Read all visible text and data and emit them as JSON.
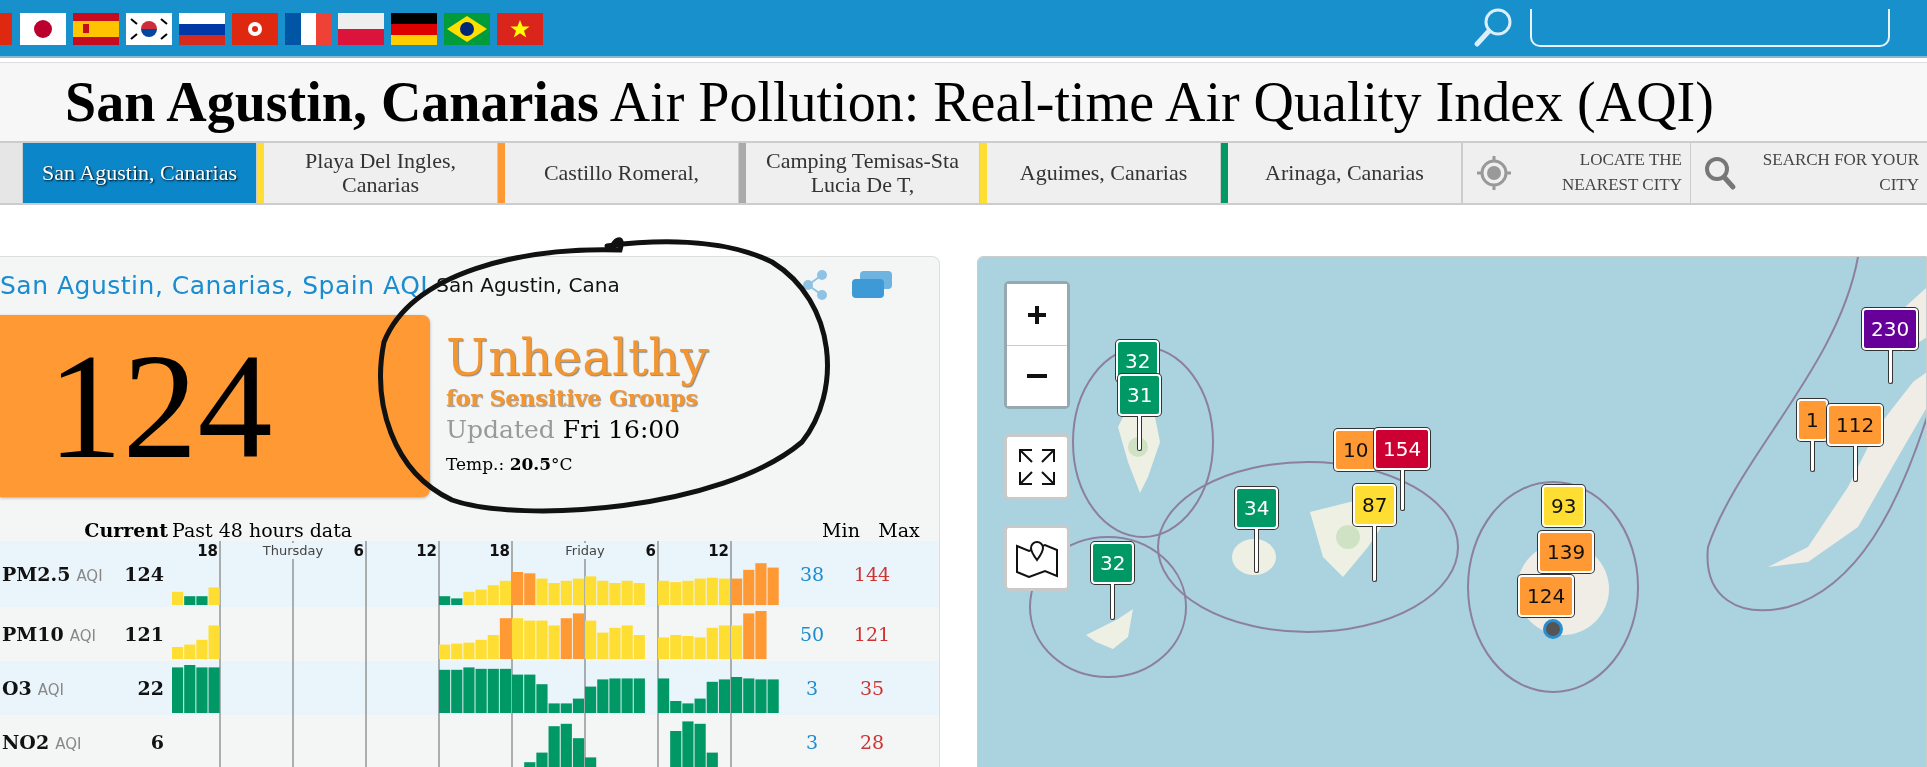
{
  "title": "**San Agustin, Canarias** Air Pollution: Real-time Air Quality Index (AQI)",
  "nav_tabs": [
    {
      "label": "San Agustin, Canarias",
      "selected": true
    },
    {
      "label": "Playa Del Ingles, Canarias",
      "selected": false,
      "color": "#ffde33"
    },
    {
      "label": "Castillo Romeral,",
      "selected": false,
      "color": "#ff9933"
    },
    {
      "label": "Camping Temisas-Sta Lucia De T,",
      "selected": false,
      "color": "#aaaaaa"
    },
    {
      "label": "Aguimes, Canarias",
      "selected": false,
      "color": "#ffde33"
    },
    {
      "label": "Arinaga, Canarias",
      "selected": false,
      "color": "#009966"
    }
  ],
  "nav_actions": [
    {
      "kind": "locate",
      "label": "LOCATE THE NEAREST CITY"
    },
    {
      "kind": "search",
      "label": "SEARCH FOR YOUR CITY"
    }
  ],
  "station": {
    "heading": "San Agustin, Canarias, Spain AQI",
    "name": "San Agustin, Cana",
    "aqi": "124",
    "status": "Unhealthy",
    "status_detail": "for Sensitive Groups",
    "updated_label": "Updated",
    "updated": "Fri 16:00",
    "temperature": "Temp.: **20.5**°C"
  },
  "table": {
    "current_header": "Current",
    "history_header": "Past 48 hours data",
    "min_header": "Min",
    "max_header": "Max",
    "ticks": [
      {
        "label": "18",
        "kind": "hour"
      },
      {
        "label": "Thursday",
        "kind": "day"
      },
      {
        "label": "6",
        "kind": "hour"
      },
      {
        "label": "12",
        "kind": "hour"
      },
      {
        "label": "18",
        "kind": "hour"
      },
      {
        "label": "Friday",
        "kind": "day"
      },
      {
        "label": "6",
        "kind": "hour"
      },
      {
        "label": "12",
        "kind": "hour"
      }
    ],
    "rows": [
      {
        "name": "PM2.5",
        "unit": "AQI",
        "current": "124",
        "min": "38",
        "max": "144"
      },
      {
        "name": "PM10",
        "unit": "AQI",
        "current": "121",
        "min": "50",
        "max": "121"
      },
      {
        "name": "O3",
        "unit": "AQI",
        "current": "22",
        "min": "3",
        "max": "35"
      },
      {
        "name": "NO2",
        "unit": "AQI",
        "current": "6",
        "min": "3",
        "max": "28"
      }
    ]
  },
  "map": {
    "markers": [
      {
        "value": "32",
        "color": "#009966"
      },
      {
        "value": "31",
        "color": "#009966"
      },
      {
        "value": "34",
        "color": "#009966"
      },
      {
        "value": "32",
        "color": "#009966"
      },
      {
        "value": "10",
        "color": "#ff9933"
      },
      {
        "value": "154",
        "color": "#cc0033"
      },
      {
        "value": "87",
        "color": "#ffde33"
      },
      {
        "value": "93",
        "color": "#ffde33"
      },
      {
        "value": "139",
        "color": "#ff9933"
      },
      {
        "value": "124",
        "color": "#ff9933"
      },
      {
        "value": "1",
        "color": "#ff9933"
      },
      {
        "value": "112",
        "color": "#ff9933"
      },
      {
        "value": "230",
        "color": "#660099"
      }
    ]
  }
}
